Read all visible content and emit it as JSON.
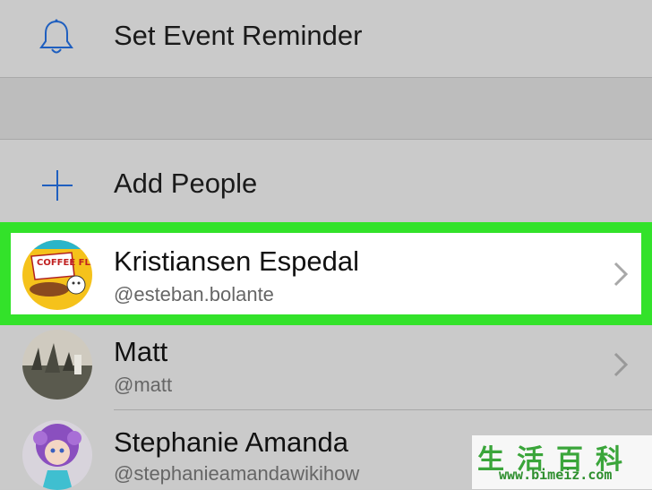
{
  "menu": {
    "reminder_label": "Set Event Reminder",
    "reminder_icon": "bell-icon",
    "add_people_label": "Add People",
    "add_people_icon": "plus-icon"
  },
  "people": [
    {
      "name": "Kristiansen Espedal",
      "handle": "@esteban.bolante",
      "avatar_text": "COFFEE FLAKES!",
      "highlighted": true
    },
    {
      "name": "Matt",
      "handle": "@matt",
      "highlighted": false
    },
    {
      "name": "Stephanie Amanda",
      "handle": "@stephanieamandawikihow",
      "highlighted": false
    }
  ],
  "colors": {
    "accent": "#1f5fbf",
    "highlight": "#33e22a",
    "background": "#cacaca"
  },
  "watermark": {
    "chars": "生活百科",
    "url": "www.bimeiz.com"
  }
}
